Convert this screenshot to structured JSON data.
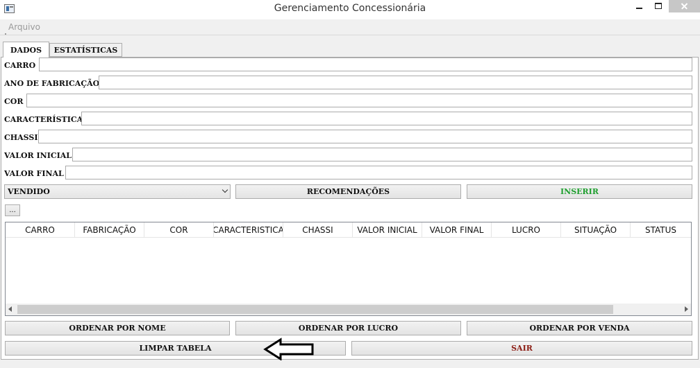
{
  "window": {
    "title": "Gerenciamento Concessionária"
  },
  "menu": {
    "items": [
      {
        "label": "Arquivo"
      }
    ]
  },
  "tabs": [
    {
      "label": "DADOS",
      "active": true
    },
    {
      "label": "ESTATÍSTICAS",
      "active": false
    }
  ],
  "form": {
    "fields": [
      {
        "label": "CARRO",
        "value": ""
      },
      {
        "label": "ANO DE FABRICAÇÃO",
        "value": ""
      },
      {
        "label": "COR",
        "value": ""
      },
      {
        "label": "CARACTERÍSTICA",
        "value": ""
      },
      {
        "label": "CHASSI",
        "value": ""
      },
      {
        "label": "VALOR INICIAL",
        "value": ""
      },
      {
        "label": "VALOR FINAL",
        "value": ""
      }
    ],
    "status_select": {
      "selected": "VENDIDO"
    },
    "recommend_button": "RECOMENDAÇÕES",
    "insert_button": "INSERIR",
    "more_button": "..."
  },
  "table": {
    "columns": [
      "CARRO",
      "FABRICAÇÃO",
      "COR",
      "CARACTERISTICA",
      "CHASSI",
      "VALOR INICIAL",
      "VALOR FINAL",
      "LUCRO",
      "SITUAÇÃO",
      "STATUS"
    ],
    "rows": []
  },
  "actions": {
    "sort_by_name": "ORDENAR POR NOME",
    "sort_by_profit": "ORDENAR POR LUCRO",
    "sort_by_sale": "ORDENAR POR VENDA",
    "clear_table": "LIMPAR TABELA",
    "exit": "SAIR"
  },
  "colors": {
    "insert_text": "#1e9e2e",
    "exit_text": "#8b1b12"
  }
}
